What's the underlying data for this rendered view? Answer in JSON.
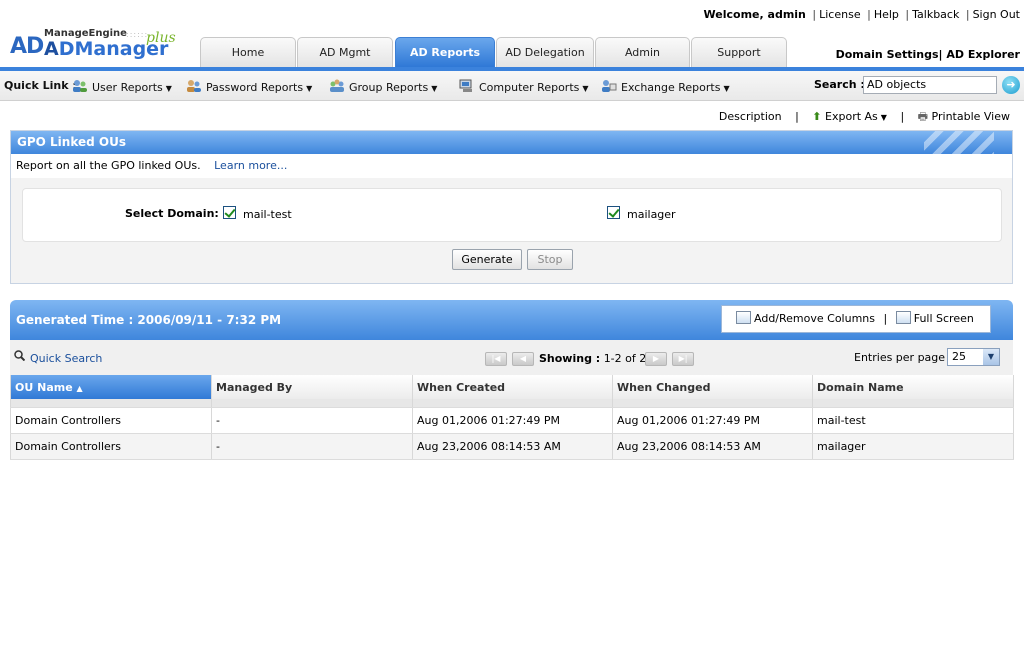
{
  "header": {
    "welcome_prefix": "Welcome,",
    "user": "admin",
    "links": [
      "License",
      "Help",
      "Talkback",
      "Sign Out"
    ],
    "logo_company": "ManageEngine",
    "logo_ad": "AD",
    "logo_product_a": "A",
    "logo_product_b": "DManager",
    "logo_plus": "plus",
    "domain_settings": "Domain Settings",
    "ad_explorer": "AD Explorer"
  },
  "tabs": [
    {
      "label": "Home"
    },
    {
      "label": "AD Mgmt"
    },
    {
      "label": "AD Reports",
      "active": true
    },
    {
      "label": "AD Delegation"
    },
    {
      "label": "Admin"
    },
    {
      "label": "Support"
    }
  ],
  "quicklinks": {
    "label": "Quick Link :",
    "items": [
      {
        "label": "User Reports"
      },
      {
        "label": "Password Reports"
      },
      {
        "label": "Group Reports"
      },
      {
        "label": "Computer Reports"
      },
      {
        "label": "Exchange Reports"
      }
    ]
  },
  "search": {
    "label": "Search :",
    "value": "AD objects"
  },
  "actions": {
    "description": "Description",
    "export": "Export As",
    "print": "Printable View"
  },
  "report": {
    "title": "GPO Linked OUs",
    "description": "Report on all the GPO linked OUs.",
    "learn_more": "Learn more...",
    "select_domain_label": "Select Domain:",
    "domains": [
      {
        "name": "mail-test",
        "checked": true
      },
      {
        "name": "mailager",
        "checked": true
      }
    ],
    "generate": "Generate",
    "stop": "Stop"
  },
  "results": {
    "generated": "Generated Time : 2006/09/11 - 7:32 PM",
    "add_remove": "Add/Remove Columns",
    "full_screen": "Full Screen",
    "quick_search": "Quick Search",
    "showing_label": "Showing :",
    "showing_value": "1-2 of 2",
    "entries_label": "Entries per page",
    "entries_value": "25",
    "columns": [
      "OU Name",
      "Managed By",
      "When Created",
      "When Changed",
      "Domain Name"
    ],
    "rows": [
      [
        "Domain Controllers",
        "-",
        "Aug 01,2006 01:27:49 PM",
        "Aug 01,2006 01:27:49 PM",
        "mail-test"
      ],
      [
        "Domain Controllers",
        "-",
        "Aug 23,2006 08:14:53 AM",
        "Aug 23,2006 08:14:53 AM",
        "mailager"
      ]
    ]
  },
  "colors": {
    "accent": "#3b82dc",
    "tab_active": "#2f78d6",
    "link": "#1a4f9c"
  }
}
